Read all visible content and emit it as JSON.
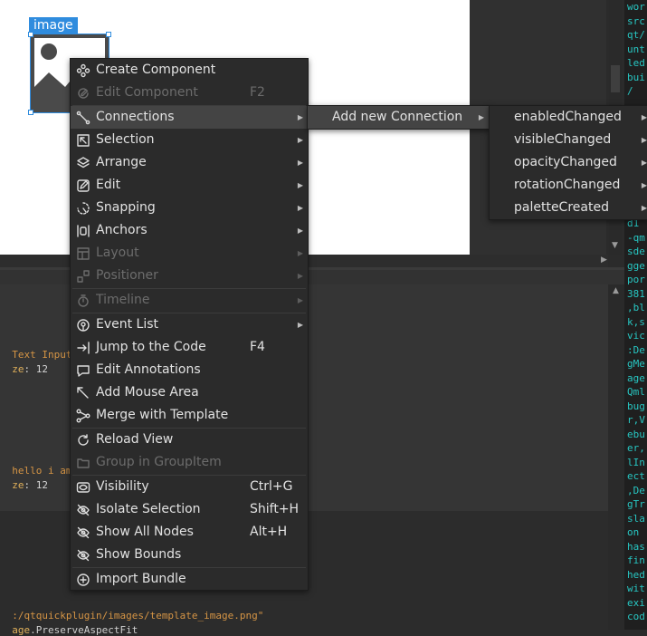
{
  "canvas": {
    "image_label": "image"
  },
  "context_menu": {
    "items": [
      {
        "label": "Create Component",
        "shortcut": "",
        "icon": "component-icon",
        "disabled": false,
        "submenu": false
      },
      {
        "label": "Edit Component",
        "shortcut": "F2",
        "icon": "edit-component-icon",
        "disabled": true,
        "submenu": false
      },
      {
        "label": "Connections",
        "shortcut": "",
        "icon": "connections-icon",
        "disabled": false,
        "submenu": true,
        "highlighted": true
      },
      {
        "label": "Selection",
        "shortcut": "",
        "icon": "selection-icon",
        "disabled": false,
        "submenu": true
      },
      {
        "label": "Arrange",
        "shortcut": "",
        "icon": "arrange-icon",
        "disabled": false,
        "submenu": true
      },
      {
        "label": "Edit",
        "shortcut": "",
        "icon": "edit-icon",
        "disabled": false,
        "submenu": true
      },
      {
        "label": "Snapping",
        "shortcut": "",
        "icon": "snapping-icon",
        "disabled": false,
        "submenu": true
      },
      {
        "label": "Anchors",
        "shortcut": "",
        "icon": "anchors-icon",
        "disabled": false,
        "submenu": true
      },
      {
        "label": "Layout",
        "shortcut": "",
        "icon": "layout-icon",
        "disabled": true,
        "submenu": true
      },
      {
        "label": "Positioner",
        "shortcut": "",
        "icon": "positioner-icon",
        "disabled": true,
        "submenu": true
      },
      {
        "label": "Timeline",
        "shortcut": "",
        "icon": "timeline-icon",
        "disabled": true,
        "submenu": true
      },
      {
        "label": "Event List",
        "shortcut": "",
        "icon": "event-list-icon",
        "disabled": false,
        "submenu": true
      },
      {
        "label": "Jump to the Code",
        "shortcut": "F4",
        "icon": "jump-to-code-icon",
        "disabled": false,
        "submenu": false
      },
      {
        "label": "Edit Annotations",
        "shortcut": "",
        "icon": "annotation-icon",
        "disabled": false,
        "submenu": false
      },
      {
        "label": "Add Mouse Area",
        "shortcut": "",
        "icon": "mouse-area-icon",
        "disabled": false,
        "submenu": false
      },
      {
        "label": "Merge with Template",
        "shortcut": "",
        "icon": "merge-icon",
        "disabled": false,
        "submenu": false
      },
      {
        "label": "Reload View",
        "shortcut": "",
        "icon": "reload-icon",
        "disabled": false,
        "submenu": false
      },
      {
        "label": "Group in GroupItem",
        "shortcut": "",
        "icon": "group-icon",
        "disabled": true,
        "submenu": false
      },
      {
        "label": "Visibility",
        "shortcut": "Ctrl+G",
        "icon": "visibility-icon",
        "disabled": false,
        "submenu": false
      },
      {
        "label": "Isolate Selection",
        "shortcut": "Shift+H",
        "icon": "isolate-icon",
        "disabled": false,
        "submenu": false
      },
      {
        "label": "Show All Nodes",
        "shortcut": "Alt+H",
        "icon": "show-all-icon",
        "disabled": false,
        "submenu": false
      },
      {
        "label": "Show Bounds",
        "shortcut": "",
        "icon": "show-bounds-icon",
        "disabled": false,
        "submenu": false
      },
      {
        "label": "Import Bundle",
        "shortcut": "",
        "icon": "import-icon",
        "disabled": false,
        "submenu": false
      }
    ]
  },
  "connections_submenu": {
    "items": [
      {
        "label": "Add new Connection"
      }
    ]
  },
  "signals_submenu": {
    "items": [
      {
        "label": "enabledChanged"
      },
      {
        "label": "visibleChanged"
      },
      {
        "label": "opacityChanged"
      },
      {
        "label": "rotationChanged"
      },
      {
        "label": "paletteCreated"
      }
    ]
  },
  "code_editor": {
    "line1_string": "Text Input\"",
    "line2_prop": "ze",
    "line2_value": ": 12",
    "line3_string": "hello i am",
    "line4_prop": "ze",
    "line4_value": ": 12",
    "line5_string": ":/qtquickplugin/images/template_image.png\"",
    "line6_prop": "age",
    "line6_value": ".PreserveAspectFit"
  },
  "right_panel": {
    "lines_top": [
      "wor",
      "src",
      "qt/",
      "unt",
      "led",
      "bui",
      "/"
    ],
    "lines_bottom": [
      "d1",
      "-qm",
      "sde",
      "gge",
      "por",
      "381",
      ",bl",
      "k,s",
      "vic",
      ":De",
      "gMe",
      "age",
      "Qml",
      "bug",
      "r,V",
      "ebu",
      "er,",
      "lIn",
      "ect",
      ",De",
      "gTr",
      "sla",
      "on",
      "has",
      "fin",
      "hed",
      "wit",
      "exi",
      "cod"
    ]
  },
  "colors": {
    "selection_blue": "#2f8cde",
    "menu_bg": "#2b2b2b",
    "menu_highlight": "#444444",
    "right_panel_text": "#27c6c2"
  }
}
